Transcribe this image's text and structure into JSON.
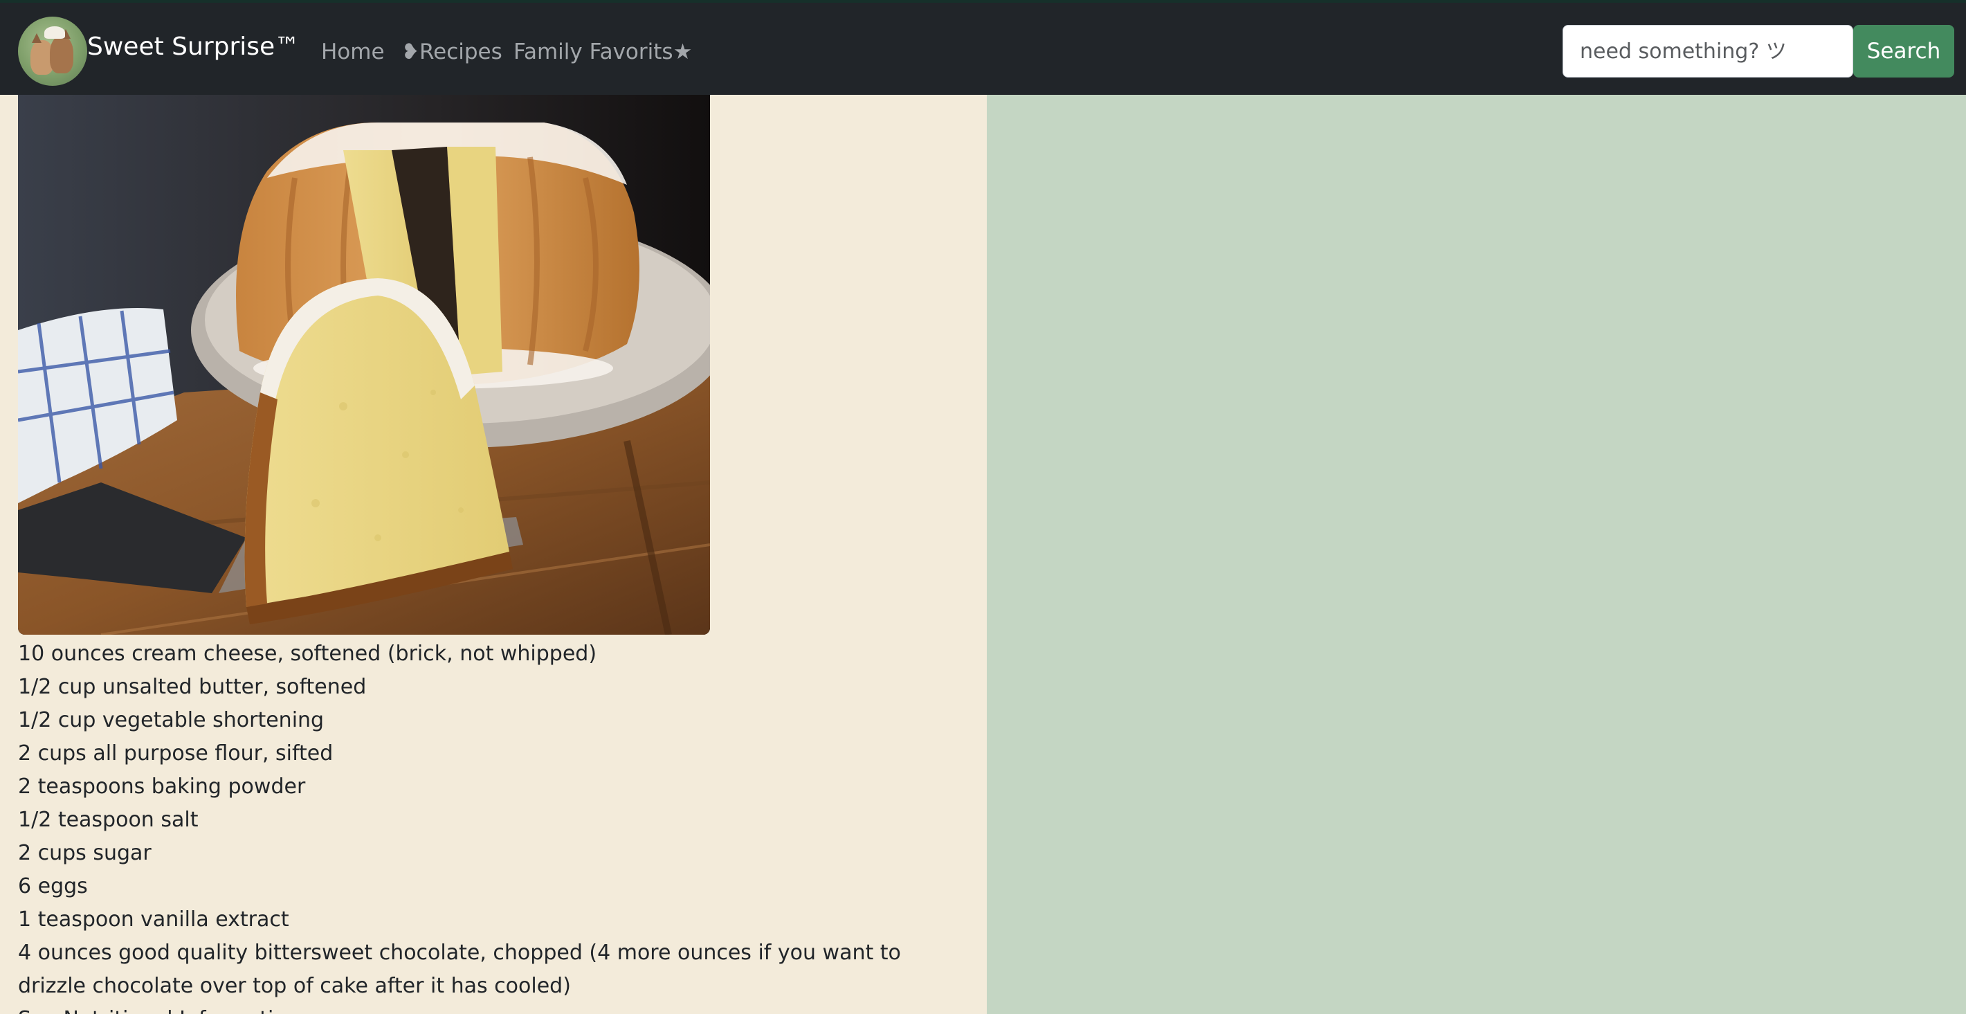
{
  "navbar": {
    "brand_name": "Sweet Surprise™",
    "logo_icon": "cats-logo-icon",
    "links": [
      {
        "label": "Home"
      },
      {
        "label": "❥Recipes"
      },
      {
        "label": "Family Favorits★"
      }
    ],
    "search": {
      "placeholder": "need something? ツ",
      "button_label": "Search"
    }
  },
  "recipe": {
    "image_alt": "Chocolate chip cream cheese pound cake",
    "ingredients": [
      "10 ounces cream cheese, softened (brick, not whipped)",
      "1/2 cup unsalted butter, softened",
      "1/2 cup vegetable shortening",
      "2 cups all purpose flour, sifted",
      "2 teaspoons baking powder",
      "1/2 teaspoon salt",
      "2 cups sugar",
      "6 eggs",
      "1 teaspoon vanilla extract",
      "4 ounces good quality bittersweet chocolate, chopped (4 more ounces if you want to drizzle chocolate over top of cake after it has cooled)",
      "See Nutritional Information"
    ]
  },
  "colors": {
    "navbar_bg": "#212529",
    "left_panel_bg": "#f3ebda",
    "page_bg": "#c4d6c3",
    "search_button_bg": "#438a5e"
  }
}
